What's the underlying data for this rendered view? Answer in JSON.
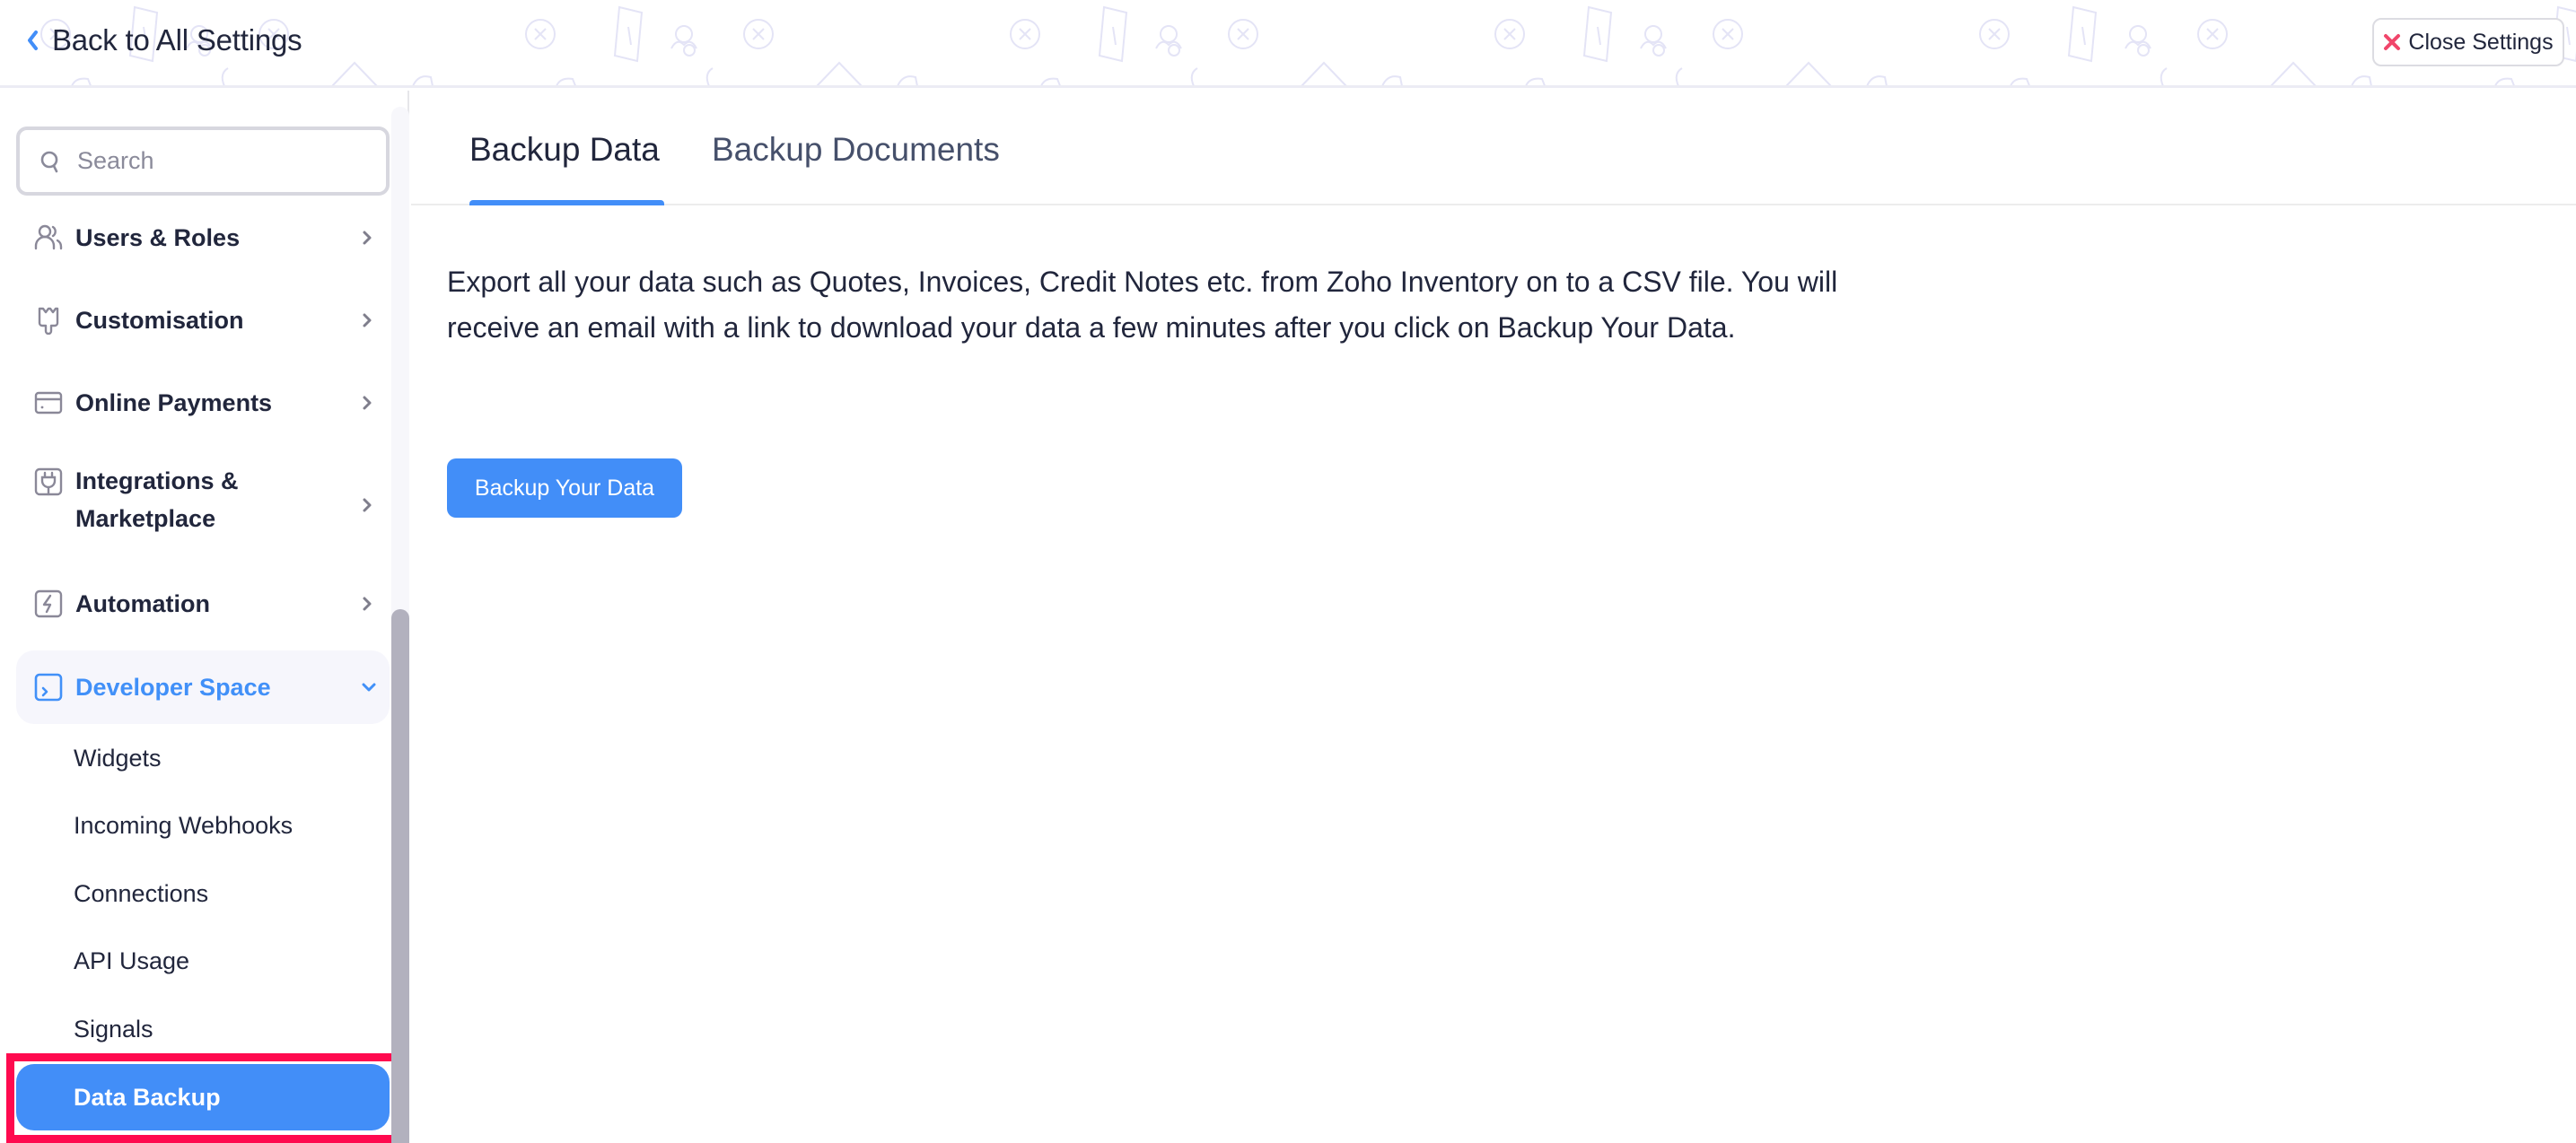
{
  "header": {
    "back_label": "Back to All Settings",
    "close_label": "Close Settings",
    "close_icon_color": "#f1466b"
  },
  "sidebar": {
    "search": {
      "placeholder": "Search",
      "value": ""
    },
    "items": [
      {
        "label": "Users & Roles",
        "icon": "users-icon",
        "expandable": true
      },
      {
        "label": "Customisation",
        "icon": "paintbrush-icon",
        "expandable": true
      },
      {
        "label": "Online Payments",
        "icon": "credit-card-icon",
        "expandable": true
      },
      {
        "label": "Integrations & Marketplace",
        "label_line1": "Integrations &",
        "label_line2": "Marketplace",
        "icon": "plug-icon",
        "expandable": true
      },
      {
        "label": "Automation",
        "icon": "lightning-icon",
        "expandable": true
      },
      {
        "label": "Developer Space",
        "icon": "terminal-icon",
        "expanded": true
      }
    ],
    "sub_items": [
      {
        "label": "Widgets"
      },
      {
        "label": "Incoming Webhooks"
      },
      {
        "label": "Connections"
      },
      {
        "label": "API Usage"
      },
      {
        "label": "Signals"
      },
      {
        "label": "Data Backup",
        "selected": true
      }
    ]
  },
  "main": {
    "tabs": [
      {
        "label": "Backup Data",
        "active": true
      },
      {
        "label": "Backup Documents",
        "active": false
      }
    ],
    "description": "Export all your data such as Quotes, Invoices, Credit Notes etc. from Zoho Inventory on to a CSV file. You will receive an email with a link to download your data a few minutes after you click on Backup Your Data.",
    "primary_button_label": "Backup Your Data"
  },
  "colors": {
    "accent": "#428ef8",
    "text": "#21263c",
    "highlight": "#ff0a4f"
  }
}
